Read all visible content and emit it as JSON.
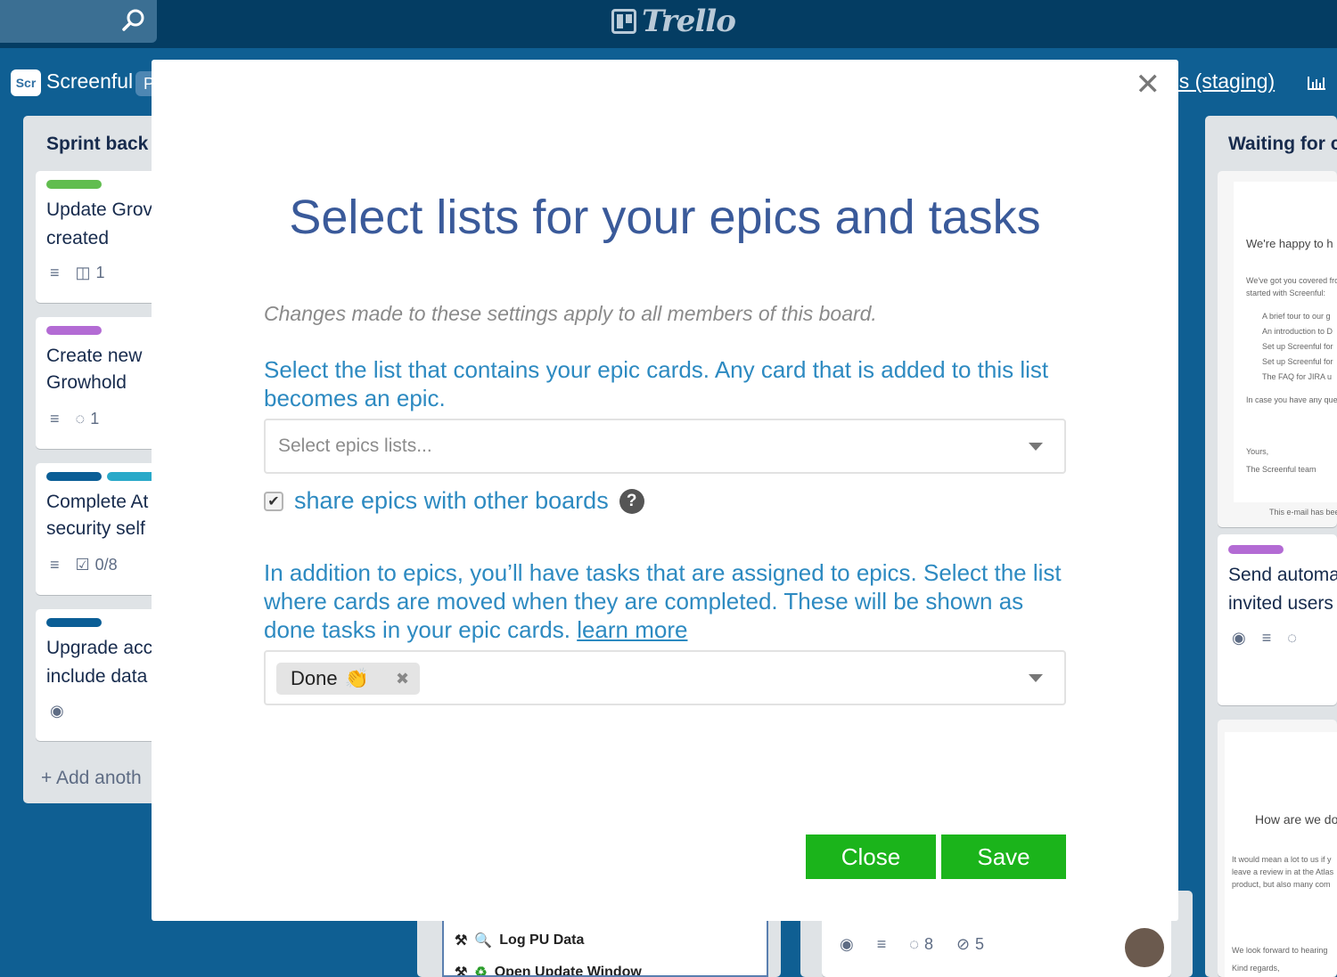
{
  "topbar": {
    "logo_text": "Trello"
  },
  "board": {
    "icon_text": "Scr",
    "title": "Screenful",
    "pill": "P",
    "link": "ds (staging)"
  },
  "lists": {
    "left_title": "Sprint back",
    "right_title": "Waiting for c",
    "add_another": "+ Add anoth",
    "cards": [
      {
        "line1": "Update Grov",
        "line2": "created",
        "badge_count": "1"
      },
      {
        "line1": "Create new",
        "line2": "Growhold",
        "badge_count": "1"
      },
      {
        "line1": "Complete At",
        "line2": "security self",
        "badge_count": "0/8"
      },
      {
        "line1": "Upgrade acc",
        "line2": "include data"
      }
    ],
    "right_card": {
      "line1": "Send automa",
      "line2": "invited users"
    },
    "email1": {
      "heading": "We're happy to h",
      "intro": "We've got you covered fro",
      "intro2": "started with Screenful:",
      "bullets": [
        "A brief tour to our g",
        "An introduction to D",
        "Set up Screenful for",
        "Set up Screenful for",
        "The FAQ for JIRA u"
      ],
      "contact": "In case you have any que",
      "sign1": "Yours,",
      "sign2": "The Screenful team",
      "footer": "This e-mail has bee"
    },
    "email2": {
      "heading": "How are we do",
      "body1": "It would mean a lot to us if y",
      "body2": "leave a review in at the Atlas",
      "body3": "product, but also many com",
      "closing1": "We look forward to hearing",
      "closing2": "Kind regards,"
    },
    "bottom_items": [
      "Log PU Data",
      "Open Update Window"
    ],
    "bottom_badges": {
      "comments": "8",
      "attachments": "5"
    }
  },
  "modal": {
    "close_symbol": "✕",
    "title": "Select lists for your epics and tasks",
    "note": "Changes made to these settings apply to all members of this board.",
    "epics_question": "Select the list that contains your epic cards. Any card that is added to this list becomes an epic.",
    "epics_placeholder": "Select epics lists...",
    "share_label": "share epics with other boards",
    "help_symbol": "?",
    "tasks_question": "In addition to epics, you’ll have tasks that are assigned to epics. Select the list where cards are moved when they are completed. These will be shown as done tasks in your epic cards.",
    "learn_more": "learn more",
    "done_tag": "Done",
    "done_emoji": "👏",
    "tag_remove": "✖",
    "close_label": "Close",
    "save_label": "Save"
  }
}
